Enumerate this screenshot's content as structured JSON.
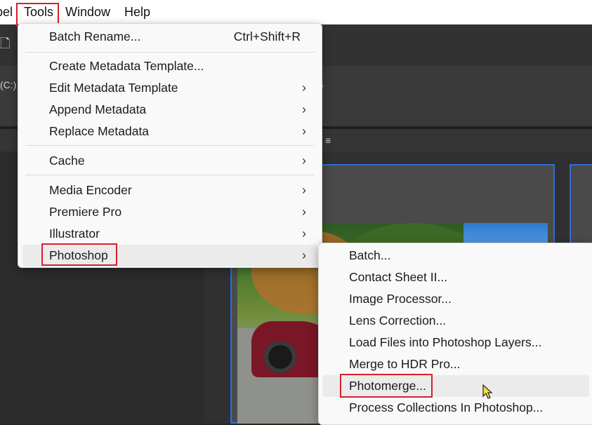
{
  "menubar": {
    "items": [
      "pel",
      "Tools",
      "Window",
      "Help"
    ]
  },
  "background": {
    "drive_label": "(C:)",
    "faint_char": "5",
    "panel_menu_glyph": "≡",
    "doc_icon": "document-icon"
  },
  "tools_menu": {
    "items": [
      {
        "label": "Batch Rename...",
        "shortcut": "Ctrl+Shift+R"
      },
      {
        "label": "Create Metadata Template..."
      },
      {
        "label": "Edit Metadata Template",
        "submenu": true
      },
      {
        "label": "Append Metadata",
        "submenu": true
      },
      {
        "label": "Replace Metadata",
        "submenu": true
      },
      {
        "label": "Cache",
        "submenu": true
      },
      {
        "label": "Media Encoder",
        "submenu": true
      },
      {
        "label": "Premiere Pro",
        "submenu": true
      },
      {
        "label": "Illustrator",
        "submenu": true
      },
      {
        "label": "Photoshop",
        "submenu": true,
        "highlighted": true
      }
    ],
    "chevron": "›"
  },
  "photoshop_submenu": {
    "items": [
      "Batch...",
      "Contact Sheet II...",
      "Image Processor...",
      "Lens Correction...",
      "Load Files into Photoshop Layers...",
      "Merge to HDR Pro...",
      "Photomerge...",
      "Process Collections In Photoshop..."
    ],
    "highlighted_index": 6
  },
  "colors": {
    "highlight_box": "#d2222d",
    "selection_border": "#2f6fd6"
  }
}
